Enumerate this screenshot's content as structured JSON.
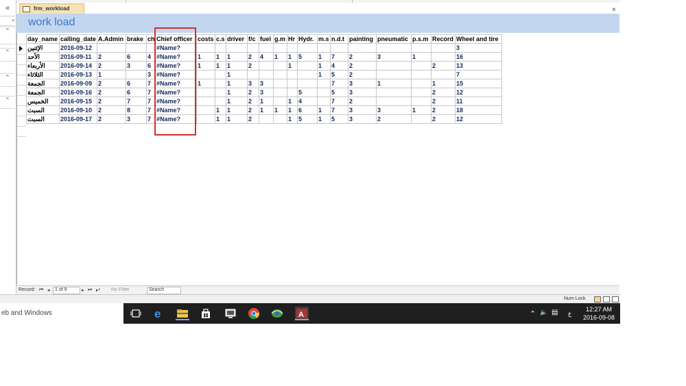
{
  "nav": {
    "collapse_glyph": "«",
    "search_glyph": "⌕",
    "group_glyph": "⌃"
  },
  "window": {
    "tab_label": "frm_workload",
    "close_glyph": "×"
  },
  "form": {
    "title": "work load"
  },
  "table": {
    "columns": [
      "day_name",
      "calling_date",
      "A.Admin",
      "brake",
      "ch",
      "Chief officer",
      "costs",
      "c.s",
      "driver",
      "f/c",
      "fuel",
      "g.m",
      "Hr",
      "Hydr.",
      "m.s",
      "n.d.t",
      "painting",
      "pneumatic",
      "p.s.m",
      "Record",
      "Wheel and tire"
    ],
    "rows": [
      [
        "الإثنين",
        "2016-09-12",
        "",
        "",
        "",
        "#Name?",
        "",
        "",
        "",
        "",
        "",
        "",
        "",
        "",
        "",
        "",
        "",
        "",
        "",
        "",
        "3"
      ],
      [
        "الأحد",
        "2016-09-11",
        "2",
        "6",
        "4",
        "#Name?",
        "1",
        "1",
        "1",
        "2",
        "4",
        "1",
        "1",
        "5",
        "1",
        "7",
        "2",
        "3",
        "1",
        "",
        "16"
      ],
      [
        "الأربعاء",
        "2016-09-14",
        "2",
        "3",
        "6",
        "#Name?",
        "1",
        "1",
        "1",
        "2",
        "",
        "",
        "1",
        "",
        "1",
        "4",
        "2",
        "",
        "",
        "2",
        "13"
      ],
      [
        "الثلاثاء",
        "2016-09-13",
        "1",
        "",
        "3",
        "#Name?",
        "",
        "",
        "1",
        "",
        "",
        "",
        "",
        "",
        "1",
        "5",
        "2",
        "",
        "",
        "",
        "7"
      ],
      [
        "الجمعة",
        "2016-09-09",
        "2",
        "6",
        "7",
        "#Name?",
        "1",
        "",
        "1",
        "3",
        "3",
        "",
        "",
        "",
        "",
        "7",
        "3",
        "1",
        "",
        "1",
        "15"
      ],
      [
        "الجمعة",
        "2016-09-16",
        "2",
        "6",
        "7",
        "#Name?",
        "",
        "",
        "1",
        "2",
        "3",
        "",
        "",
        "5",
        "",
        "5",
        "3",
        "",
        "",
        "2",
        "12"
      ],
      [
        "الخميس",
        "2016-09-15",
        "2",
        "7",
        "7",
        "#Name?",
        "",
        "",
        "1",
        "2",
        "1",
        "",
        "1",
        "4",
        "",
        "7",
        "2",
        "",
        "",
        "2",
        "11"
      ],
      [
        "السبت",
        "2016-09-10",
        "2",
        "8",
        "7",
        "#Name?",
        "",
        "1",
        "1",
        "2",
        "1",
        "1",
        "1",
        "6",
        "1",
        "7",
        "3",
        "3",
        "1",
        "2",
        "18"
      ],
      [
        "السبت",
        "2016-09-17",
        "2",
        "3",
        "7",
        "#Name?",
        "",
        "1",
        "1",
        "2",
        "",
        "",
        "1",
        "5",
        "1",
        "5",
        "3",
        "2",
        "",
        "2",
        "12"
      ]
    ]
  },
  "record_nav": {
    "label": "Record:",
    "first": "⏮",
    "prev": "◂",
    "position": "1 of 9",
    "next": "▸",
    "last": "⏭",
    "new": "▸*",
    "filter": "No Filter",
    "search": "Search"
  },
  "statusbar": {
    "numlock": "Num Lock"
  },
  "taskbar": {
    "search_text": "eb and Windows",
    "icons": [
      "task-view",
      "edge",
      "file-explorer",
      "store",
      "remote-desktop",
      "chrome",
      "photos",
      "access"
    ]
  },
  "tray": {
    "chevron": "⌃",
    "volume": "🔈",
    "notify": "▤",
    "lang": "ع",
    "time": "12:27 AM",
    "date": "2016-09-08"
  }
}
